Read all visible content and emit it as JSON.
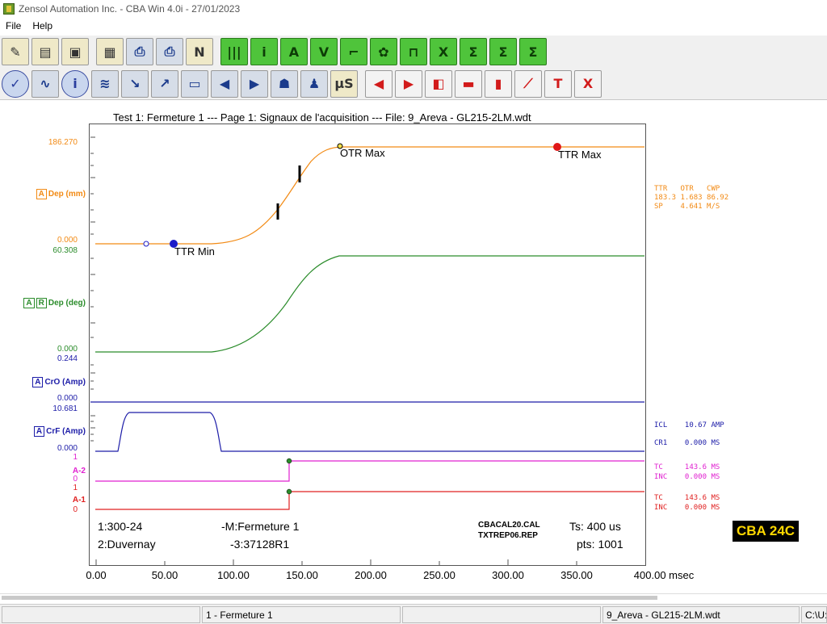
{
  "window": {
    "title": "Zensol Automation Inc. - CBA Win 4.0i - 27/01/2023"
  },
  "menu": [
    "File",
    "Help"
  ],
  "toolbar1": [
    {
      "icon": "magic-wand-icon",
      "glyph": "✎"
    },
    {
      "icon": "open-folder-icon",
      "glyph": "▤"
    },
    {
      "icon": "save-disk-icon",
      "glyph": "▣"
    },
    {
      "icon": "report-icon",
      "glyph": "▦"
    },
    {
      "icon": "printer-icon",
      "glyph": "⎙"
    },
    {
      "icon": "printer-stack-icon",
      "glyph": "⎙"
    },
    {
      "icon": "print-preview-icon",
      "glyph": "N"
    },
    {
      "icon": "channels-icon",
      "glyph": "|||"
    },
    {
      "icon": "info-circle-icon",
      "glyph": "i"
    },
    {
      "icon": "ammeter-icon",
      "glyph": "A"
    },
    {
      "icon": "voltmeter-icon",
      "glyph": "V"
    },
    {
      "icon": "step-wave-icon",
      "glyph": "⌐"
    },
    {
      "icon": "gear-icon",
      "glyph": "✿"
    },
    {
      "icon": "pulse-icon",
      "glyph": "⊓"
    },
    {
      "icon": "excel-icon",
      "glyph": "X"
    },
    {
      "icon": "sigma-wave-icon",
      "glyph": "Σ"
    },
    {
      "icon": "sigma-slope-icon",
      "glyph": "Σ"
    },
    {
      "icon": "sigma-icon",
      "glyph": "Σ"
    }
  ],
  "toolbar2": [
    {
      "icon": "check-circle-icon",
      "glyph": "✓"
    },
    {
      "icon": "waveform-icon",
      "glyph": "∿"
    },
    {
      "icon": "info-icon",
      "glyph": "i"
    },
    {
      "icon": "multi-wave-icon",
      "glyph": "≋"
    },
    {
      "icon": "curve-arrow-red-icon",
      "glyph": "↘"
    },
    {
      "icon": "curve-arrow-green-icon",
      "glyph": "↗"
    },
    {
      "icon": "table-window-icon",
      "glyph": "▭"
    },
    {
      "icon": "arrow-left-icon",
      "glyph": "◀"
    },
    {
      "icon": "arrow-right-icon",
      "glyph": "▶"
    },
    {
      "icon": "runner-icon",
      "glyph": "☗"
    },
    {
      "icon": "multi-runner-icon",
      "glyph": "♟"
    },
    {
      "icon": "timer-us-icon",
      "glyph": "µS"
    },
    {
      "icon": "red-arrow-left-icon",
      "glyph": "◀"
    },
    {
      "icon": "red-arrow-right-icon",
      "glyph": "▶"
    },
    {
      "icon": "split-view-icon",
      "glyph": "◧"
    },
    {
      "icon": "ruler-horizontal-icon",
      "glyph": "▬"
    },
    {
      "icon": "ruler-vertical-icon",
      "glyph": "▮"
    },
    {
      "icon": "curve-chart-icon",
      "glyph": "⟋"
    },
    {
      "icon": "text-tool-icon",
      "glyph": "T"
    },
    {
      "icon": "excel-red-icon",
      "glyph": "X"
    }
  ],
  "plot": {
    "title": "Test 1: Fermeture 1 --- Page 1: Signaux de l'acquisition --- File: 9_Areva - GL215-2LM.wdt"
  },
  "channels": {
    "dep_mm": {
      "label": "Dep (mm)",
      "box": "A",
      "max": "186.270",
      "min": "0.000",
      "color": "#f28a14"
    },
    "dep_deg": {
      "label": "Dep (deg)",
      "box1": "A",
      "box2": "R",
      "max": "60.308",
      "min": "0.000",
      "color": "#2b8c2b"
    },
    "cro": {
      "label": "CrO (Amp)",
      "box": "A",
      "max": "0.244",
      "min": "0.000",
      "color": "#1c1ca8"
    },
    "crf": {
      "label": "CrF (Amp)",
      "box": "A",
      "max": "10.681",
      "min": "0.000",
      "color": "#1c1ca8"
    },
    "a2": {
      "label": "A-2",
      "high": "1",
      "low": "0",
      "color": "#e020d0"
    },
    "a1": {
      "label": "A-1",
      "high": "1",
      "low": "0",
      "color": "#e02020"
    }
  },
  "markers": {
    "ttr_min": "TTR Min",
    "otr_max": "OTR Max",
    "ttr_max": "TTR Max"
  },
  "measurements": {
    "motion_header": "TTR   OTR   CWP",
    "motion_values": "183.3 1.683 86.92",
    "speed": "SP    4.641 M/S",
    "icl": "ICL    10.67 AMP",
    "cr1": "CR1    0.000 MS",
    "a2_tc": "TC     143.6 MS",
    "a2_inc": "INC    0.000 MS",
    "a1_tc": "TC     143.6 MS",
    "a1_inc": "INC    0.000 MS"
  },
  "info": {
    "line1_left": "1:300-24",
    "line1_mid": "-M:Fermeture 1",
    "line2_left": "2:Duvernay",
    "line2_mid": "-3:37128R1",
    "cal_file": "CBACAL20.CAL",
    "rep_file": "TXTREP06.REP",
    "ts": "Ts: 400 us",
    "pts": "pts: 1001"
  },
  "x_axis": {
    "ticks": [
      "0.00",
      "50.00",
      "100.00",
      "150.00",
      "200.00",
      "250.00",
      "300.00",
      "350.00",
      "400.00 msec"
    ]
  },
  "badge": "CBA 24C",
  "status": {
    "test": "1 - Fermeture 1",
    "file": "9_Areva - GL215-2LM.wdt",
    "path": "C:\\U:"
  }
}
